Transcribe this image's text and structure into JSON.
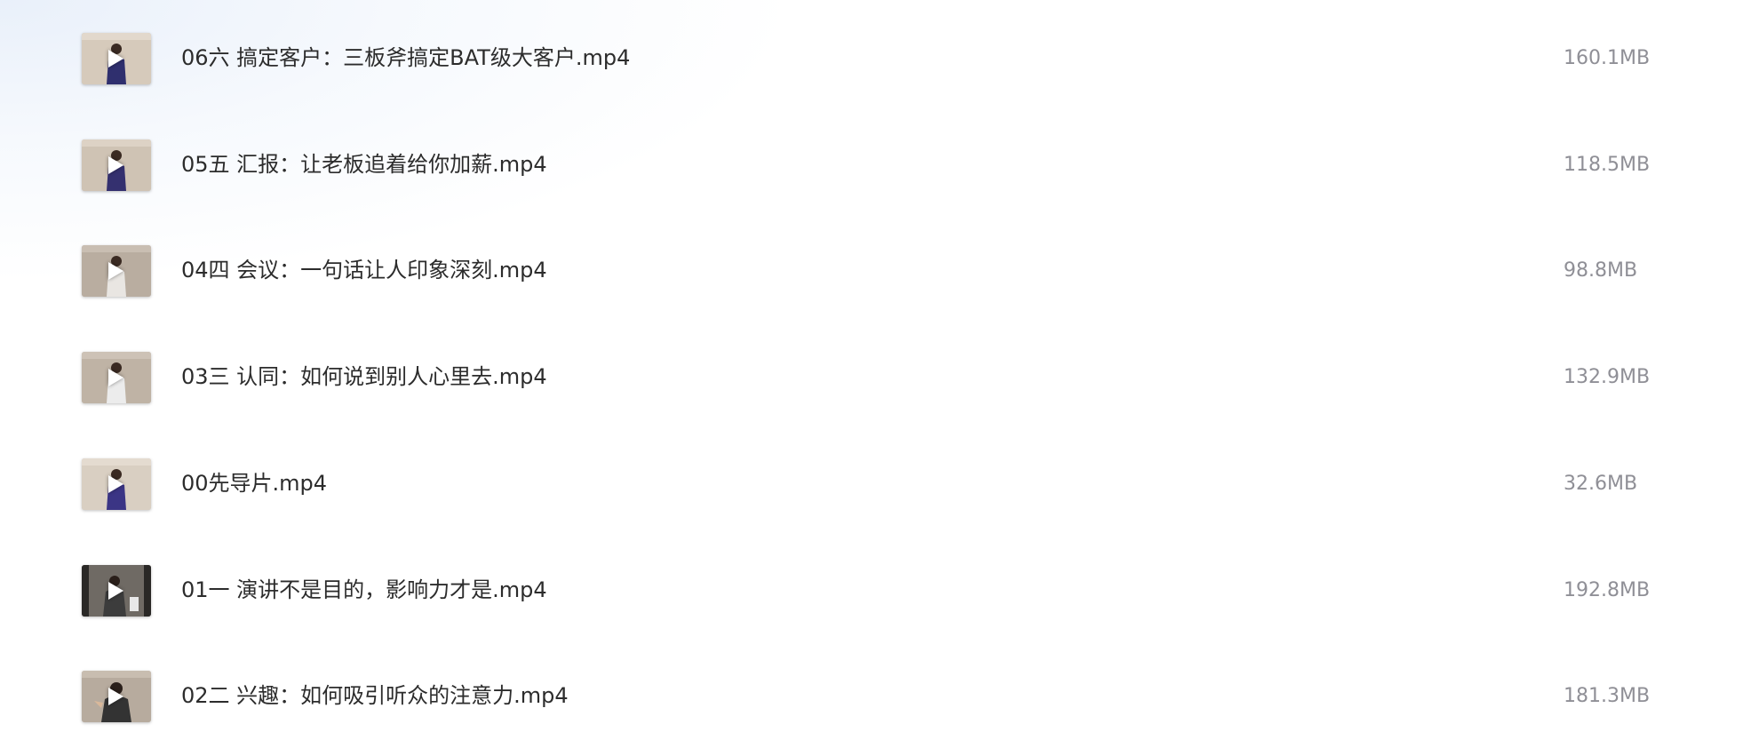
{
  "files": [
    {
      "name": "06六 搞定客户：三板斧搞定BAT级大客户.mp4",
      "size": "160.1MB",
      "icon": "play-icon"
    },
    {
      "name": "05五 汇报：让老板追着给你加薪.mp4",
      "size": "118.5MB",
      "icon": "play-icon"
    },
    {
      "name": "04四 会议：一句话让人印象深刻.mp4",
      "size": "98.8MB",
      "icon": "play-icon"
    },
    {
      "name": "03三 认同：如何说到别人心里去.mp4",
      "size": "132.9MB",
      "icon": "play-icon"
    },
    {
      "name": "00先导片.mp4",
      "size": "32.6MB",
      "icon": "play-icon"
    },
    {
      "name": "01一 演讲不是目的，影响力才是.mp4",
      "size": "192.8MB",
      "icon": "play-icon"
    },
    {
      "name": "02二 兴趣：如何吸引听众的注意力.mp4",
      "size": "181.3MB",
      "icon": "play-icon"
    }
  ],
  "colors": {
    "name_text": "#2c2c2c",
    "size_text": "#8f8f96",
    "play_glyph": "#ffffff"
  }
}
